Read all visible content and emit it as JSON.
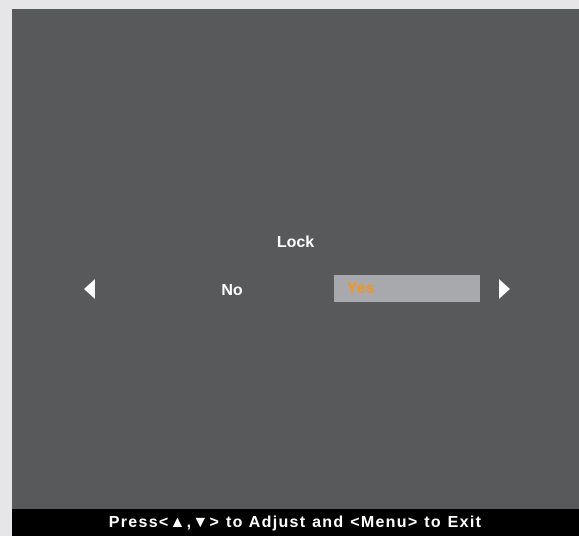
{
  "menu": {
    "title": "Lock",
    "options": [
      {
        "label": "No",
        "selected": false
      },
      {
        "label": "Yes",
        "selected": true
      }
    ],
    "left_arrow_icon": "triangle-left-icon",
    "right_arrow_icon": "triangle-right-icon"
  },
  "footer": {
    "hint": "Press<▲,▼> to Adjust and <Menu> to Exit"
  },
  "colors": {
    "page_background": "#e6e6e8",
    "screen_background": "#58595b",
    "selected_background": "#a7a9ac",
    "selected_text": "#f7941d",
    "text": "#ffffff",
    "footer_background": "#000000"
  }
}
